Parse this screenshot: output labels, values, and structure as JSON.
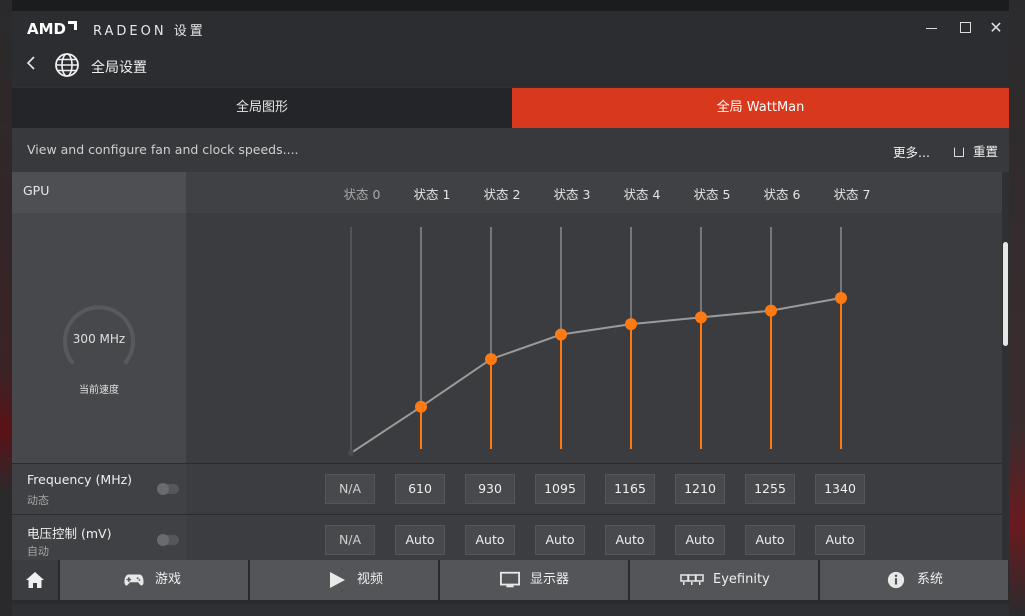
{
  "window": {
    "brand": "AMD",
    "title": "RADEON 设置",
    "controls": {
      "minimize": "minimize-icon",
      "maximize": "maximize-icon",
      "close": "close-icon"
    }
  },
  "header": {
    "back_icon": "back-arrow-icon",
    "page_icon": "globe-icon",
    "page_title": "全局设置"
  },
  "tabs": [
    {
      "label": "全局图形",
      "active": false
    },
    {
      "label": "全局 WattMan",
      "active": true
    }
  ],
  "toolbar": {
    "description": "View and configure fan and clock speeds....",
    "more_label": "更多...",
    "reset_label": "重置"
  },
  "gpu": {
    "label": "GPU",
    "gauge_value": "300 MHz",
    "gauge_caption": "当前速度"
  },
  "chart_data": {
    "type": "line",
    "categories": [
      "状态 0",
      "状态 1",
      "状态 2",
      "状态 3",
      "状态 4",
      "状态 5",
      "状态 6",
      "状态 7"
    ],
    "series": [
      {
        "values": [
          300,
          610,
          930,
          1095,
          1165,
          1210,
          1255,
          1340
        ]
      }
    ],
    "ylim": [
      300,
      1340
    ],
    "colors": {
      "point": "#ff7a12",
      "line": "#9a9a9a",
      "guide": "#8a8b8e",
      "disabled_guide": "#5c5d60"
    }
  },
  "frequency_row": {
    "title": "Frequency (MHz)",
    "subtitle": "动态",
    "values": [
      "N/A",
      "610",
      "930",
      "1095",
      "1165",
      "1210",
      "1255",
      "1340"
    ]
  },
  "voltage_row": {
    "title": "电压控制 (mV)",
    "subtitle": "自动",
    "values": [
      "N/A",
      "Auto",
      "Auto",
      "Auto",
      "Auto",
      "Auto",
      "Auto",
      "Auto"
    ]
  },
  "bottom_nav": [
    {
      "label": "",
      "icon": "home-icon"
    },
    {
      "label": "游戏",
      "icon": "gamepad-icon"
    },
    {
      "label": "视频",
      "icon": "play-icon"
    },
    {
      "label": "显示器",
      "icon": "monitor-icon"
    },
    {
      "label": "Eyefinity",
      "icon": "eyefinity-icon"
    },
    {
      "label": "系统",
      "icon": "info-icon"
    }
  ],
  "colors": {
    "accent": "#d8381c"
  }
}
